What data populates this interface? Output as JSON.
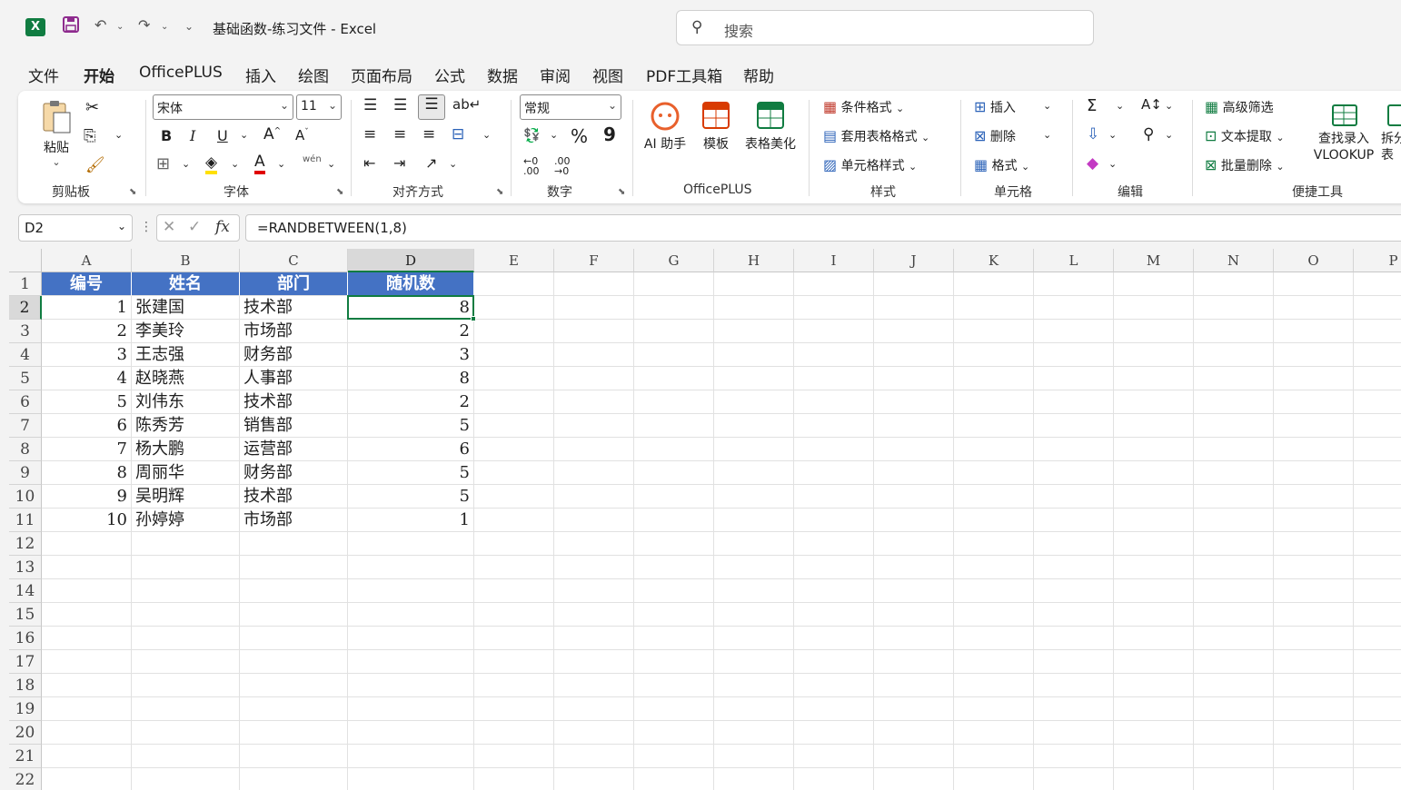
{
  "title_bar": {
    "doc_title": "基础函数-练习文件  -  Excel",
    "search_placeholder": "搜索",
    "app_icon": "X"
  },
  "menu": [
    "文件",
    "开始",
    "OfficePLUS",
    "插入",
    "绘图",
    "页面布局",
    "公式",
    "数据",
    "审阅",
    "视图",
    "PDF工具箱",
    "帮助"
  ],
  "menu_active": "开始",
  "ribbon": {
    "clipboard": {
      "paste": "粘贴",
      "label": "剪贴板"
    },
    "font": {
      "name": "宋体",
      "size": "11",
      "label": "字体",
      "phonetic": "wén"
    },
    "alignment": {
      "label": "对齐方式"
    },
    "number": {
      "format": "常规",
      "percent": "%",
      "comma": "9",
      "label": "数字"
    },
    "officeplus": {
      "ai": "AI 助手",
      "template": "模板",
      "beautify": "表格美化",
      "label": "OfficePLUS"
    },
    "styles": {
      "conditional": "条件格式",
      "table_format": "套用表格格式",
      "cell_style": "单元格样式",
      "label": "样式"
    },
    "cells": {
      "insert": "插入",
      "delete": "删除",
      "format": "格式",
      "label": "单元格"
    },
    "editing": {
      "label": "编辑"
    },
    "quick_tools": {
      "advanced_filter": "高级筛选",
      "text_extract": "文本提取",
      "batch_delete": "批量删除",
      "lookup_line1": "查找录入",
      "lookup_line2": "VLOOKUP",
      "split_line1": "拆分",
      "split_line2": "表",
      "label": "便捷工具"
    }
  },
  "formula_bar": {
    "name_box": "D2",
    "fx": "fx",
    "formula": "=RANDBETWEEN(1,8)"
  },
  "columns": [
    "A",
    "B",
    "C",
    "D",
    "E",
    "F",
    "G",
    "H",
    "I",
    "J",
    "K",
    "L",
    "M",
    "N",
    "O",
    "P"
  ],
  "row_numbers": [
    "1",
    "2",
    "3",
    "4",
    "5",
    "6",
    "7",
    "8",
    "9",
    "10",
    "11",
    "12",
    "13",
    "14",
    "15",
    "16",
    "17",
    "18",
    "19",
    "20",
    "21",
    "22"
  ],
  "table": {
    "headers": [
      "编号",
      "姓名",
      "部门",
      "随机数"
    ],
    "rows": [
      [
        "1",
        "张建国",
        "技术部",
        "8"
      ],
      [
        "2",
        "李美玲",
        "市场部",
        "2"
      ],
      [
        "3",
        "王志强",
        "财务部",
        "3"
      ],
      [
        "4",
        "赵晓燕",
        "人事部",
        "8"
      ],
      [
        "5",
        "刘伟东",
        "技术部",
        "2"
      ],
      [
        "6",
        "陈秀芳",
        "销售部",
        "5"
      ],
      [
        "7",
        "杨大鹏",
        "运营部",
        "6"
      ],
      [
        "8",
        "周丽华",
        "财务部",
        "5"
      ],
      [
        "9",
        "吴明辉",
        "技术部",
        "5"
      ],
      [
        "10",
        "孙婷婷",
        "市场部",
        "1"
      ]
    ]
  },
  "colors": {
    "accent": "#107c41",
    "header_fill": "#4472c4"
  }
}
